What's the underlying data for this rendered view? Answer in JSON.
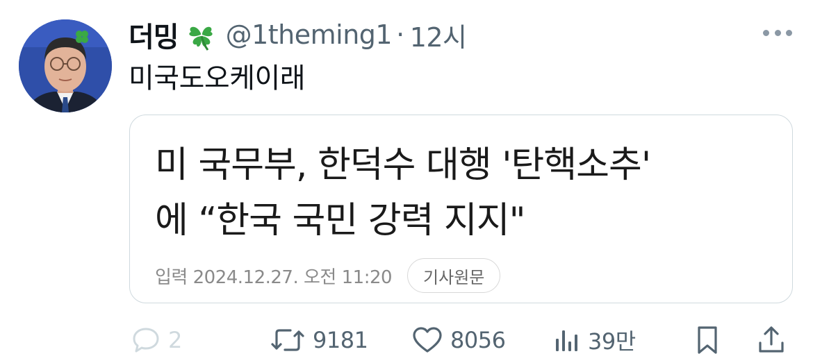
{
  "tweet": {
    "display_name": "더밍",
    "name_emoji": "clover-icon",
    "handle": "@1theming1",
    "separator": "·",
    "time": "12시",
    "text": "미국도오케이래"
  },
  "card": {
    "headline_line1": "미 국무부, 한덕수 대행 '탄핵소추'",
    "headline_line2": "에 “한국 국민 강력 지지\"",
    "date_text": "입력 2024.12.27. 오전 11:20",
    "origin_button_label": "기사원문"
  },
  "actions": {
    "reply_count": "2",
    "retweet_count": "9181",
    "like_count": "8056",
    "views_count": "39만"
  },
  "colors": {
    "text_primary": "#0f1419",
    "text_secondary": "#536471",
    "border": "#cfd9de",
    "clover": "#3aa845",
    "avatar_bg": "#2f4fa9"
  }
}
